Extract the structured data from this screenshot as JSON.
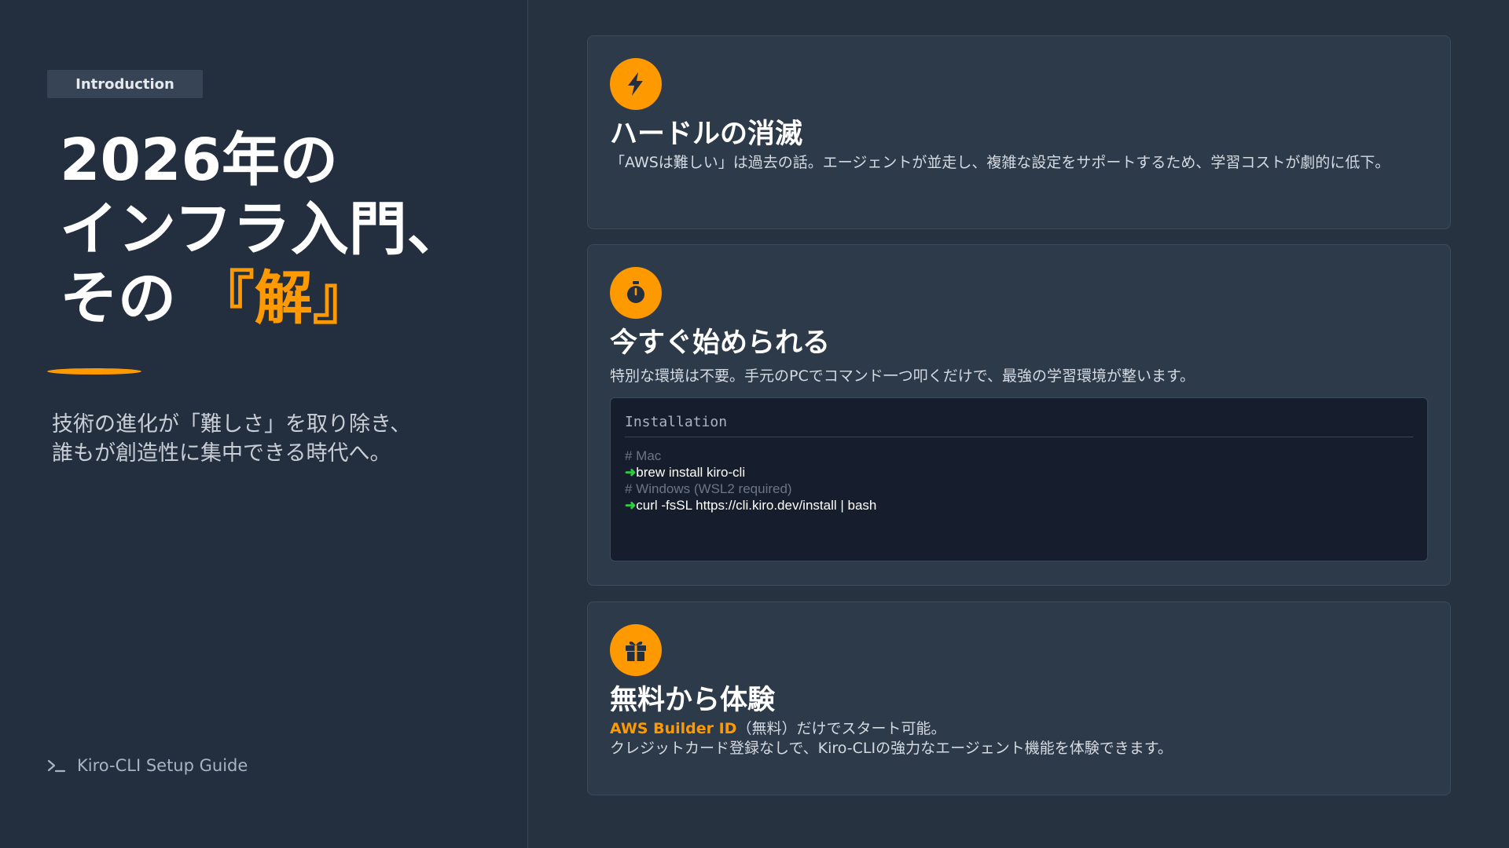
{
  "left": {
    "badge": "Introduction",
    "title": {
      "line1": "2026年の",
      "line2": "インフラ入門、",
      "line3_prefix": "その",
      "line3_accent": "『解』"
    },
    "subtitle": {
      "line1": "技術の進化が「難しさ」を取り除き、",
      "line2": "誰もが創造性に集中できる時代へ。"
    },
    "footer": "Kiro-CLI Setup Guide"
  },
  "cards": {
    "card1": {
      "icon": "lightning-icon",
      "title": "ハードルの消滅",
      "text": "「AWSは難しい」は過去の話。エージェントが並走し、複雑な設定をサポートするため、学習コストが劇的に低下。"
    },
    "card2": {
      "icon": "stopwatch-icon",
      "title": "今すぐ始められる",
      "text": "特別な環境は不要。手元のPCでコマンド一つ叩くだけで、最強の学習環境が整います。",
      "terminal": {
        "header": "Installation",
        "comment_mac": "# Mac",
        "cmd_mac": "brew install kiro-cli",
        "comment_windows": "# Windows (WSL2 required)",
        "cmd_windows": "curl -fsSL https://cli.kiro.dev/install | bash",
        "arrow": "➜"
      }
    },
    "card3": {
      "icon": "gift-icon",
      "title": "無料から体験",
      "highlight": "AWS Builder ID",
      "text1_rest": "（無料）だけでスタート可能。",
      "text2": "クレジットカード登録なしで、Kiro-CLIの強力なエージェント機能を体験できます。"
    }
  },
  "colors": {
    "accent": "#ff9900",
    "background": "#232f3e",
    "card": "#2d3a4a",
    "terminal": "#161e2d",
    "prompt_arrow": "#2ecc40"
  }
}
